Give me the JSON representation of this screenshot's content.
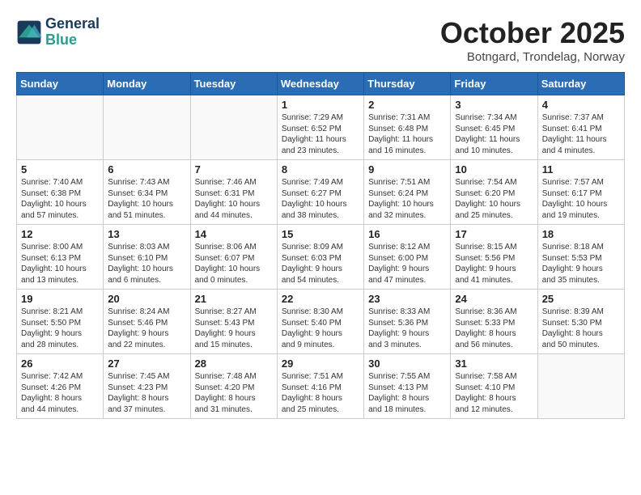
{
  "header": {
    "logo_line1": "General",
    "logo_line2": "Blue",
    "month": "October 2025",
    "location": "Botngard, Trondelag, Norway"
  },
  "weekdays": [
    "Sunday",
    "Monday",
    "Tuesday",
    "Wednesday",
    "Thursday",
    "Friday",
    "Saturday"
  ],
  "weeks": [
    [
      {
        "day": "",
        "info": ""
      },
      {
        "day": "",
        "info": ""
      },
      {
        "day": "",
        "info": ""
      },
      {
        "day": "1",
        "info": "Sunrise: 7:29 AM\nSunset: 6:52 PM\nDaylight: 11 hours\nand 23 minutes."
      },
      {
        "day": "2",
        "info": "Sunrise: 7:31 AM\nSunset: 6:48 PM\nDaylight: 11 hours\nand 16 minutes."
      },
      {
        "day": "3",
        "info": "Sunrise: 7:34 AM\nSunset: 6:45 PM\nDaylight: 11 hours\nand 10 minutes."
      },
      {
        "day": "4",
        "info": "Sunrise: 7:37 AM\nSunset: 6:41 PM\nDaylight: 11 hours\nand 4 minutes."
      }
    ],
    [
      {
        "day": "5",
        "info": "Sunrise: 7:40 AM\nSunset: 6:38 PM\nDaylight: 10 hours\nand 57 minutes."
      },
      {
        "day": "6",
        "info": "Sunrise: 7:43 AM\nSunset: 6:34 PM\nDaylight: 10 hours\nand 51 minutes."
      },
      {
        "day": "7",
        "info": "Sunrise: 7:46 AM\nSunset: 6:31 PM\nDaylight: 10 hours\nand 44 minutes."
      },
      {
        "day": "8",
        "info": "Sunrise: 7:49 AM\nSunset: 6:27 PM\nDaylight: 10 hours\nand 38 minutes."
      },
      {
        "day": "9",
        "info": "Sunrise: 7:51 AM\nSunset: 6:24 PM\nDaylight: 10 hours\nand 32 minutes."
      },
      {
        "day": "10",
        "info": "Sunrise: 7:54 AM\nSunset: 6:20 PM\nDaylight: 10 hours\nand 25 minutes."
      },
      {
        "day": "11",
        "info": "Sunrise: 7:57 AM\nSunset: 6:17 PM\nDaylight: 10 hours\nand 19 minutes."
      }
    ],
    [
      {
        "day": "12",
        "info": "Sunrise: 8:00 AM\nSunset: 6:13 PM\nDaylight: 10 hours\nand 13 minutes."
      },
      {
        "day": "13",
        "info": "Sunrise: 8:03 AM\nSunset: 6:10 PM\nDaylight: 10 hours\nand 6 minutes."
      },
      {
        "day": "14",
        "info": "Sunrise: 8:06 AM\nSunset: 6:07 PM\nDaylight: 10 hours\nand 0 minutes."
      },
      {
        "day": "15",
        "info": "Sunrise: 8:09 AM\nSunset: 6:03 PM\nDaylight: 9 hours\nand 54 minutes."
      },
      {
        "day": "16",
        "info": "Sunrise: 8:12 AM\nSunset: 6:00 PM\nDaylight: 9 hours\nand 47 minutes."
      },
      {
        "day": "17",
        "info": "Sunrise: 8:15 AM\nSunset: 5:56 PM\nDaylight: 9 hours\nand 41 minutes."
      },
      {
        "day": "18",
        "info": "Sunrise: 8:18 AM\nSunset: 5:53 PM\nDaylight: 9 hours\nand 35 minutes."
      }
    ],
    [
      {
        "day": "19",
        "info": "Sunrise: 8:21 AM\nSunset: 5:50 PM\nDaylight: 9 hours\nand 28 minutes."
      },
      {
        "day": "20",
        "info": "Sunrise: 8:24 AM\nSunset: 5:46 PM\nDaylight: 9 hours\nand 22 minutes."
      },
      {
        "day": "21",
        "info": "Sunrise: 8:27 AM\nSunset: 5:43 PM\nDaylight: 9 hours\nand 15 minutes."
      },
      {
        "day": "22",
        "info": "Sunrise: 8:30 AM\nSunset: 5:40 PM\nDaylight: 9 hours\nand 9 minutes."
      },
      {
        "day": "23",
        "info": "Sunrise: 8:33 AM\nSunset: 5:36 PM\nDaylight: 9 hours\nand 3 minutes."
      },
      {
        "day": "24",
        "info": "Sunrise: 8:36 AM\nSunset: 5:33 PM\nDaylight: 8 hours\nand 56 minutes."
      },
      {
        "day": "25",
        "info": "Sunrise: 8:39 AM\nSunset: 5:30 PM\nDaylight: 8 hours\nand 50 minutes."
      }
    ],
    [
      {
        "day": "26",
        "info": "Sunrise: 7:42 AM\nSunset: 4:26 PM\nDaylight: 8 hours\nand 44 minutes."
      },
      {
        "day": "27",
        "info": "Sunrise: 7:45 AM\nSunset: 4:23 PM\nDaylight: 8 hours\nand 37 minutes."
      },
      {
        "day": "28",
        "info": "Sunrise: 7:48 AM\nSunset: 4:20 PM\nDaylight: 8 hours\nand 31 minutes."
      },
      {
        "day": "29",
        "info": "Sunrise: 7:51 AM\nSunset: 4:16 PM\nDaylight: 8 hours\nand 25 minutes."
      },
      {
        "day": "30",
        "info": "Sunrise: 7:55 AM\nSunset: 4:13 PM\nDaylight: 8 hours\nand 18 minutes."
      },
      {
        "day": "31",
        "info": "Sunrise: 7:58 AM\nSunset: 4:10 PM\nDaylight: 8 hours\nand 12 minutes."
      },
      {
        "day": "",
        "info": ""
      }
    ]
  ]
}
